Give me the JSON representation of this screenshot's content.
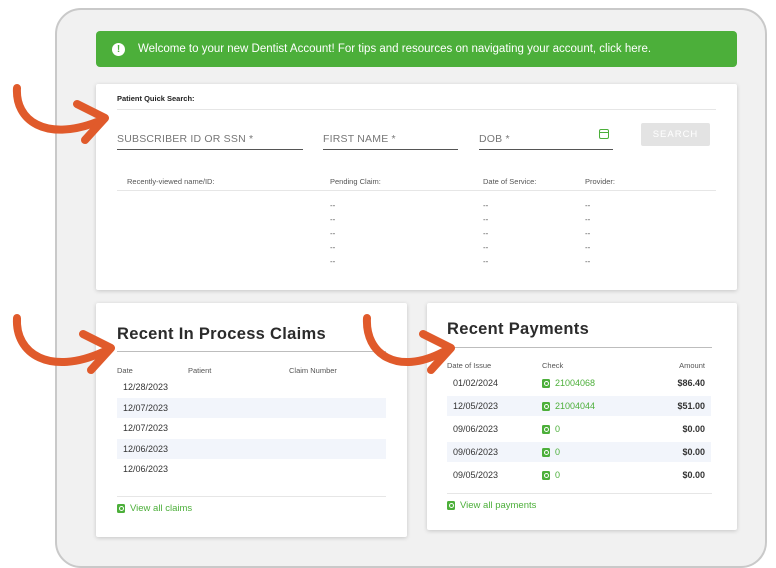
{
  "banner": {
    "text": "Welcome to your new Dentist Account! For tips and resources on navigating your account, click here.",
    "icon": "info-icon",
    "color": "#4caf3a"
  },
  "quick_search": {
    "title": "Patient Quick Search:",
    "fields": {
      "subscriber": "SUBSCRIBER ID OR SSN *",
      "first_name": "FIRST NAME *",
      "dob": "DOB *"
    },
    "search_label": "SEARCH",
    "recent_headers": [
      "Recently-viewed name/ID:",
      "Pending Claim:",
      "Date of Service:",
      "Provider:"
    ],
    "recent_rows": [
      [
        "--",
        "--",
        "--"
      ],
      [
        "--",
        "--",
        "--"
      ],
      [
        "--",
        "--",
        "--"
      ],
      [
        "--",
        "--",
        "--"
      ],
      [
        "--",
        "--",
        "--"
      ]
    ]
  },
  "claims": {
    "title": "Recent In Process Claims",
    "headers": [
      "Date",
      "Patient",
      "Claim Number"
    ],
    "rows": [
      "12/28/2023",
      "12/07/2023",
      "12/07/2023",
      "12/06/2023",
      "12/06/2023"
    ],
    "view_all": "View all claims"
  },
  "payments": {
    "title": "Recent Payments",
    "headers": [
      "Date of Issue",
      "Check",
      "Amount"
    ],
    "rows": [
      {
        "date": "01/02/2024",
        "check": "21004068",
        "amount": "$86.40"
      },
      {
        "date": "12/05/2023",
        "check": "21004044",
        "amount": "$51.00"
      },
      {
        "date": "09/06/2023",
        "check": "0",
        "amount": "$0.00"
      },
      {
        "date": "09/06/2023",
        "check": "0",
        "amount": "$0.00"
      },
      {
        "date": "09/05/2023",
        "check": "0",
        "amount": "$0.00"
      }
    ],
    "view_all": "View all payments"
  },
  "colors": {
    "accent": "#4caf3a",
    "arrow": "#e05a2b"
  }
}
